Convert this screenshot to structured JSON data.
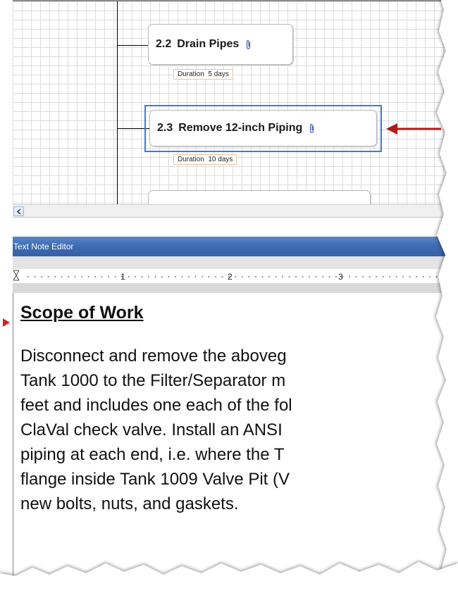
{
  "diagram": {
    "tasks": [
      {
        "number": "2.2",
        "name": "Drain Pipes",
        "duration_label": "Duration",
        "duration_value": "5 days"
      },
      {
        "number": "2.3",
        "name": "Remove 12-inch Piping",
        "duration_label": "Duration",
        "duration_value": "10 days"
      }
    ],
    "accent_color": "#3a7be0",
    "arrow_color": "#b31b1b"
  },
  "editor": {
    "title": "Text Note Editor",
    "ruler_numbers": [
      "1",
      "2",
      "3"
    ],
    "heading": "Scope of Work",
    "body_lines": [
      "Disconnect and remove the aboveg",
      "Tank 1000 to the Filter/Separator m",
      "feet and includes one each of the fol",
      "ClaVal check valve. Install an ANSI",
      "piping at each end, i.e. where the T",
      "flange inside Tank 1009 Valve Pit (V",
      "new bolts, nuts, and gaskets."
    ]
  },
  "icons": {
    "attachment": "paperclip-icon",
    "scroll_left": "chevron-left-icon",
    "callout": "red-arrow-icon"
  }
}
